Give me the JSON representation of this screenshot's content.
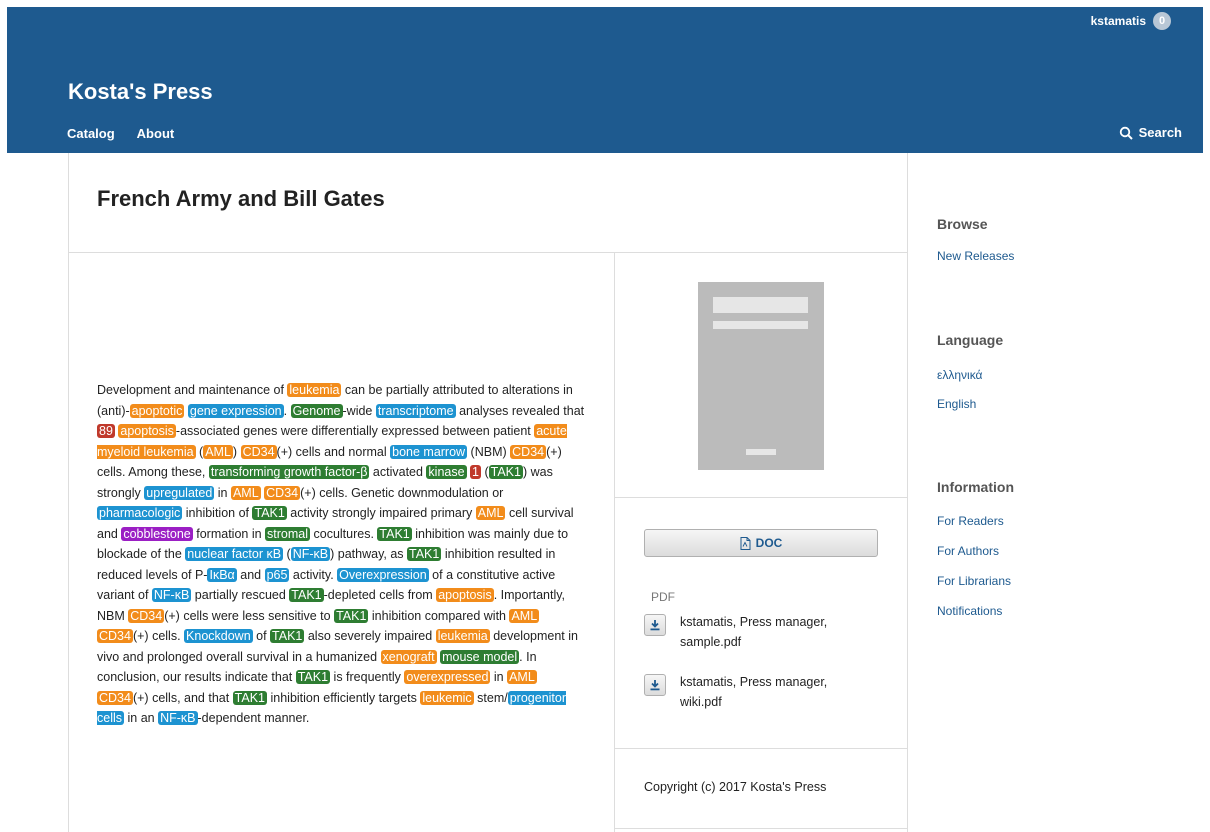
{
  "header": {
    "user": "kstamatis",
    "notification_count": "0",
    "brand": "Kosta's Press",
    "nav": [
      "Catalog",
      "About"
    ],
    "search_label": "Search"
  },
  "book": {
    "title": "French Army and Bill Gates"
  },
  "abstract": [
    {
      "t": "Development and maintenance of "
    },
    {
      "t": "leukemia",
      "c": "o"
    },
    {
      "t": " can be partially attributed to alterations in (anti)-"
    },
    {
      "t": "apoptotic",
      "c": "o"
    },
    {
      "t": " "
    },
    {
      "t": "gene expression",
      "c": "b"
    },
    {
      "t": ". "
    },
    {
      "t": "Genome",
      "c": "g"
    },
    {
      "t": "-wide "
    },
    {
      "t": "transcriptome",
      "c": "b"
    },
    {
      "t": " analyses revealed that "
    },
    {
      "t": "89",
      "c": "r"
    },
    {
      "t": " "
    },
    {
      "t": "apoptosis",
      "c": "o"
    },
    {
      "t": "-associated genes were differentially expressed between patient "
    },
    {
      "t": "acute myeloid leukemia",
      "c": "o"
    },
    {
      "t": " ("
    },
    {
      "t": "AML",
      "c": "o"
    },
    {
      "t": ") "
    },
    {
      "t": "CD34",
      "c": "o"
    },
    {
      "t": "(+) cells and normal "
    },
    {
      "t": "bone marrow",
      "c": "b"
    },
    {
      "t": " (NBM) "
    },
    {
      "t": "CD34",
      "c": "o"
    },
    {
      "t": "(+) cells. Among these, "
    },
    {
      "t": "transforming growth factor-β",
      "c": "g"
    },
    {
      "t": " activated "
    },
    {
      "t": "kinase",
      "c": "g"
    },
    {
      "t": " "
    },
    {
      "t": "1",
      "c": "r"
    },
    {
      "t": " ("
    },
    {
      "t": "TAK1",
      "c": "g"
    },
    {
      "t": ") was strongly "
    },
    {
      "t": "upregulated",
      "c": "b"
    },
    {
      "t": " in "
    },
    {
      "t": "AML",
      "c": "o"
    },
    {
      "t": " "
    },
    {
      "t": "CD34",
      "c": "o"
    },
    {
      "t": "(+) cells. Genetic downmodulation or "
    },
    {
      "t": "pharmacologic",
      "c": "b"
    },
    {
      "t": " inhibition of "
    },
    {
      "t": "TAK1",
      "c": "g"
    },
    {
      "t": " activity strongly impaired primary "
    },
    {
      "t": "AML",
      "c": "o"
    },
    {
      "t": " cell survival and "
    },
    {
      "t": "cobblestone",
      "c": "p"
    },
    {
      "t": " formation in "
    },
    {
      "t": "stromal",
      "c": "g"
    },
    {
      "t": " cocultures. "
    },
    {
      "t": "TAK1",
      "c": "g"
    },
    {
      "t": " inhibition was mainly due to blockade of the "
    },
    {
      "t": "nuclear factor κB",
      "c": "b"
    },
    {
      "t": " ("
    },
    {
      "t": "NF-κB",
      "c": "b"
    },
    {
      "t": ") pathway, as "
    },
    {
      "t": "TAK1",
      "c": "g"
    },
    {
      "t": " inhibition resulted in reduced levels of P-"
    },
    {
      "t": "IκBα",
      "c": "b"
    },
    {
      "t": " and "
    },
    {
      "t": "p65",
      "c": "b"
    },
    {
      "t": " activity. "
    },
    {
      "t": "Overexpression",
      "c": "b"
    },
    {
      "t": " of a constitutive active variant of "
    },
    {
      "t": "NF-κB",
      "c": "b"
    },
    {
      "t": " partially rescued "
    },
    {
      "t": "TAK1",
      "c": "g"
    },
    {
      "t": "-depleted cells from "
    },
    {
      "t": "apoptosis",
      "c": "o"
    },
    {
      "t": ". Importantly, NBM "
    },
    {
      "t": "CD34",
      "c": "o"
    },
    {
      "t": "(+) cells were less sensitive to "
    },
    {
      "t": "TAK1",
      "c": "g"
    },
    {
      "t": " inhibition compared with "
    },
    {
      "t": "AML",
      "c": "o"
    },
    {
      "t": " "
    },
    {
      "t": "CD34",
      "c": "o"
    },
    {
      "t": "(+) cells. "
    },
    {
      "t": "Knockdown",
      "c": "b"
    },
    {
      "t": " of "
    },
    {
      "t": "TAK1",
      "c": "g"
    },
    {
      "t": " also severely impaired "
    },
    {
      "t": "leukemia",
      "c": "o"
    },
    {
      "t": " development in vivo and prolonged overall survival in a humanized "
    },
    {
      "t": "xenograft",
      "c": "o"
    },
    {
      "t": " "
    },
    {
      "t": "mouse model",
      "c": "g"
    },
    {
      "t": ". In conclusion, our results indicate that "
    },
    {
      "t": "TAK1",
      "c": "g"
    },
    {
      "t": " is frequently "
    },
    {
      "t": "overexpressed",
      "c": "o"
    },
    {
      "t": " in "
    },
    {
      "t": "AML",
      "c": "o"
    },
    {
      "t": " "
    },
    {
      "t": "CD34",
      "c": "o"
    },
    {
      "t": "(+) cells, and that "
    },
    {
      "t": "TAK1",
      "c": "g"
    },
    {
      "t": " inhibition efficiently targets "
    },
    {
      "t": "leukemic",
      "c": "o"
    },
    {
      "t": " stem/"
    },
    {
      "t": "progenitor cells",
      "c": "b"
    },
    {
      "t": " in an "
    },
    {
      "t": "NF-κB",
      "c": "b"
    },
    {
      "t": "-dependent manner."
    }
  ],
  "files": {
    "doc_button": "DOC",
    "pdf_label": "PDF",
    "downloads": [
      {
        "label": "kstamatis, Press manager, sample.pdf"
      },
      {
        "label": "kstamatis, Press manager, wiki.pdf"
      }
    ]
  },
  "copyright": "Copyright (c) 2017 Kosta's Press",
  "sidebar": {
    "browse_heading": "Browse",
    "browse_links": [
      "New Releases"
    ],
    "language_heading": "Language",
    "language_links": [
      "ελληνικά",
      "English"
    ],
    "info_heading": "Information",
    "info_links": [
      "For Readers",
      "For Authors",
      "For Librarians",
      "Notifications"
    ]
  },
  "colors": {
    "header_bg": "#1e5a8f",
    "tag_orange": "#f28c1b",
    "tag_blue": "#1d93d1",
    "tag_green": "#2e7d32",
    "tag_red": "#c0392b",
    "tag_purple": "#9b1fc4"
  }
}
